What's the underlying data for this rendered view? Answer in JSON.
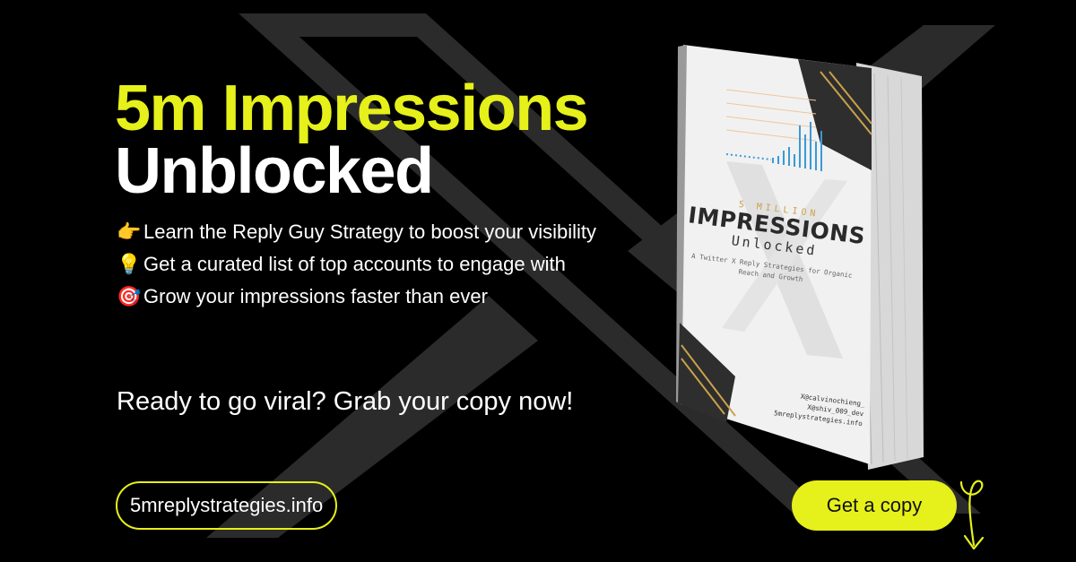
{
  "headline": {
    "line1": "5m Impressions",
    "line2": "Unblocked"
  },
  "bullets": [
    {
      "emoji": "👉",
      "text": "Learn the Reply Guy Strategy to boost your visibility"
    },
    {
      "emoji": "💡",
      "text": "Get a curated list of top accounts to engage with"
    },
    {
      "emoji": "🎯",
      "text": "Grow your impressions faster than ever"
    }
  ],
  "cta_text": "Ready to go viral? Grab your copy now!",
  "url_label": "5mreplystrategies.info",
  "button_label": "Get a copy",
  "book": {
    "kicker": "5 MILLION",
    "title": "IMPRESSIONS",
    "title2": "Unlocked",
    "description": "A Twitter X Reply Strategies for Organic Reach and Growth",
    "handles": [
      "X@calvinochieng_",
      "X@shiv_009_dev",
      "5mreplystrategies.info"
    ]
  },
  "colors": {
    "accent": "#e6f01a",
    "background": "#000000",
    "bg_x_mark": "#2b2b2b"
  },
  "icons": [
    "x-logo-icon",
    "arrow-down-icon"
  ]
}
